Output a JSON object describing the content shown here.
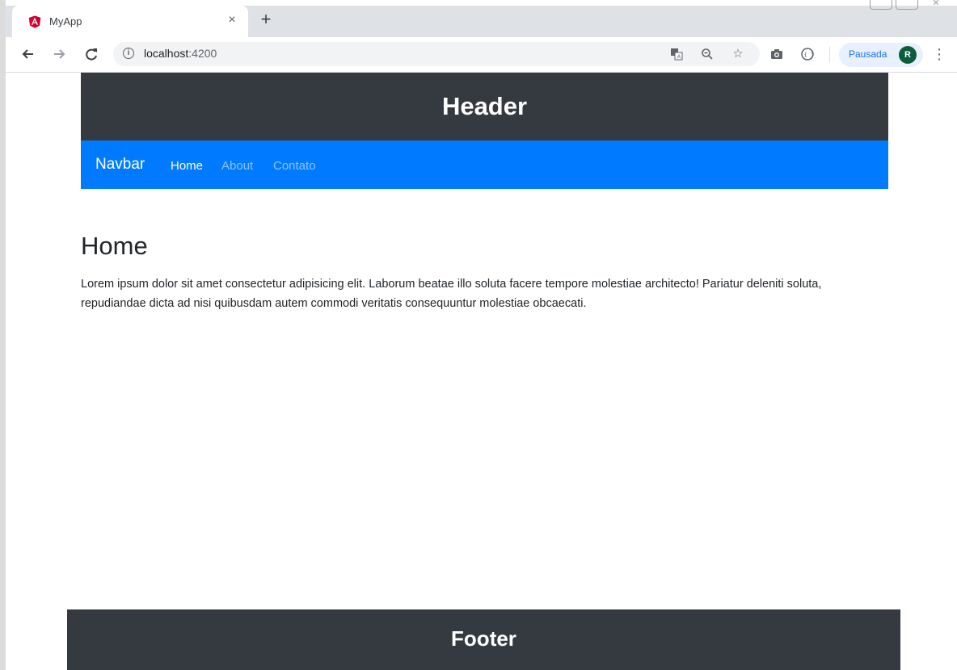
{
  "browser": {
    "tab_title": "MyApp",
    "tab_close": "×",
    "new_tab": "+",
    "url_host": "localhost",
    "url_port": ":4200",
    "profile_label": "Pausada",
    "profile_initial": "R",
    "icons": [
      "back-icon",
      "forward-icon",
      "reload-icon",
      "info-icon",
      "translate-icon",
      "zoom-icon",
      "star-icon",
      "camera-icon",
      "extension-icon",
      "menu-icon"
    ]
  },
  "header": {
    "title": "Header"
  },
  "navbar": {
    "brand": "Navbar",
    "links": [
      {
        "label": "Home",
        "active": true
      },
      {
        "label": "About",
        "active": false
      },
      {
        "label": "Contato",
        "active": false
      }
    ]
  },
  "main": {
    "title": "Home",
    "text": "Lorem ipsum dolor sit amet consectetur adipisicing elit. Laborum beatae illo soluta facere tempore molestiae architecto! Pariatur deleniti soluta, repudiandae dicta ad nisi quibusdam autem commodi veritatis consequuntur molestiae obcaecati."
  },
  "footer": {
    "title": "Footer"
  },
  "colors": {
    "dark": "#343a40",
    "primary": "#007bff",
    "angular_red": "#dd0031"
  }
}
